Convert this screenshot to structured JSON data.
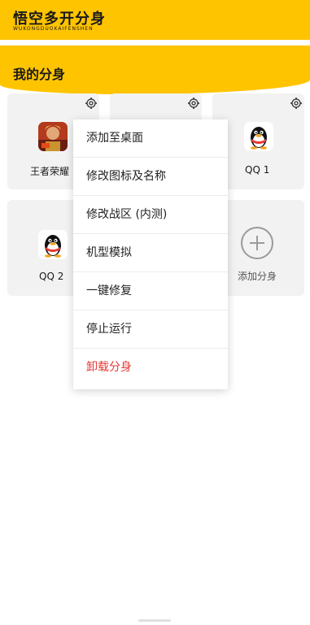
{
  "header": {
    "title": "悟空多开分身",
    "subtitle": "WUKONGDUOKAIFENSHEN"
  },
  "section": {
    "title": "我的分身"
  },
  "cards": [
    {
      "label": "王者荣耀",
      "icon": "game-hero-icon"
    },
    {
      "label": "",
      "icon": ""
    },
    {
      "label": "QQ 1",
      "icon": "qq-penguin-icon"
    },
    {
      "label": "QQ 2",
      "icon": "qq-penguin-icon"
    },
    {
      "label": "添加分身",
      "icon": "plus-circle-icon"
    }
  ],
  "context_menu": {
    "items": [
      {
        "label": "添加至桌面"
      },
      {
        "label": "修改图标及名称"
      },
      {
        "label": "修改战区 (内测)"
      },
      {
        "label": "机型模拟"
      },
      {
        "label": "一键修复"
      },
      {
        "label": "停止运行"
      },
      {
        "label": "卸载分身",
        "danger": true
      }
    ]
  },
  "colors": {
    "accent": "#ffc400",
    "danger": "#e53935",
    "card_bg": "#f2f2f2"
  }
}
